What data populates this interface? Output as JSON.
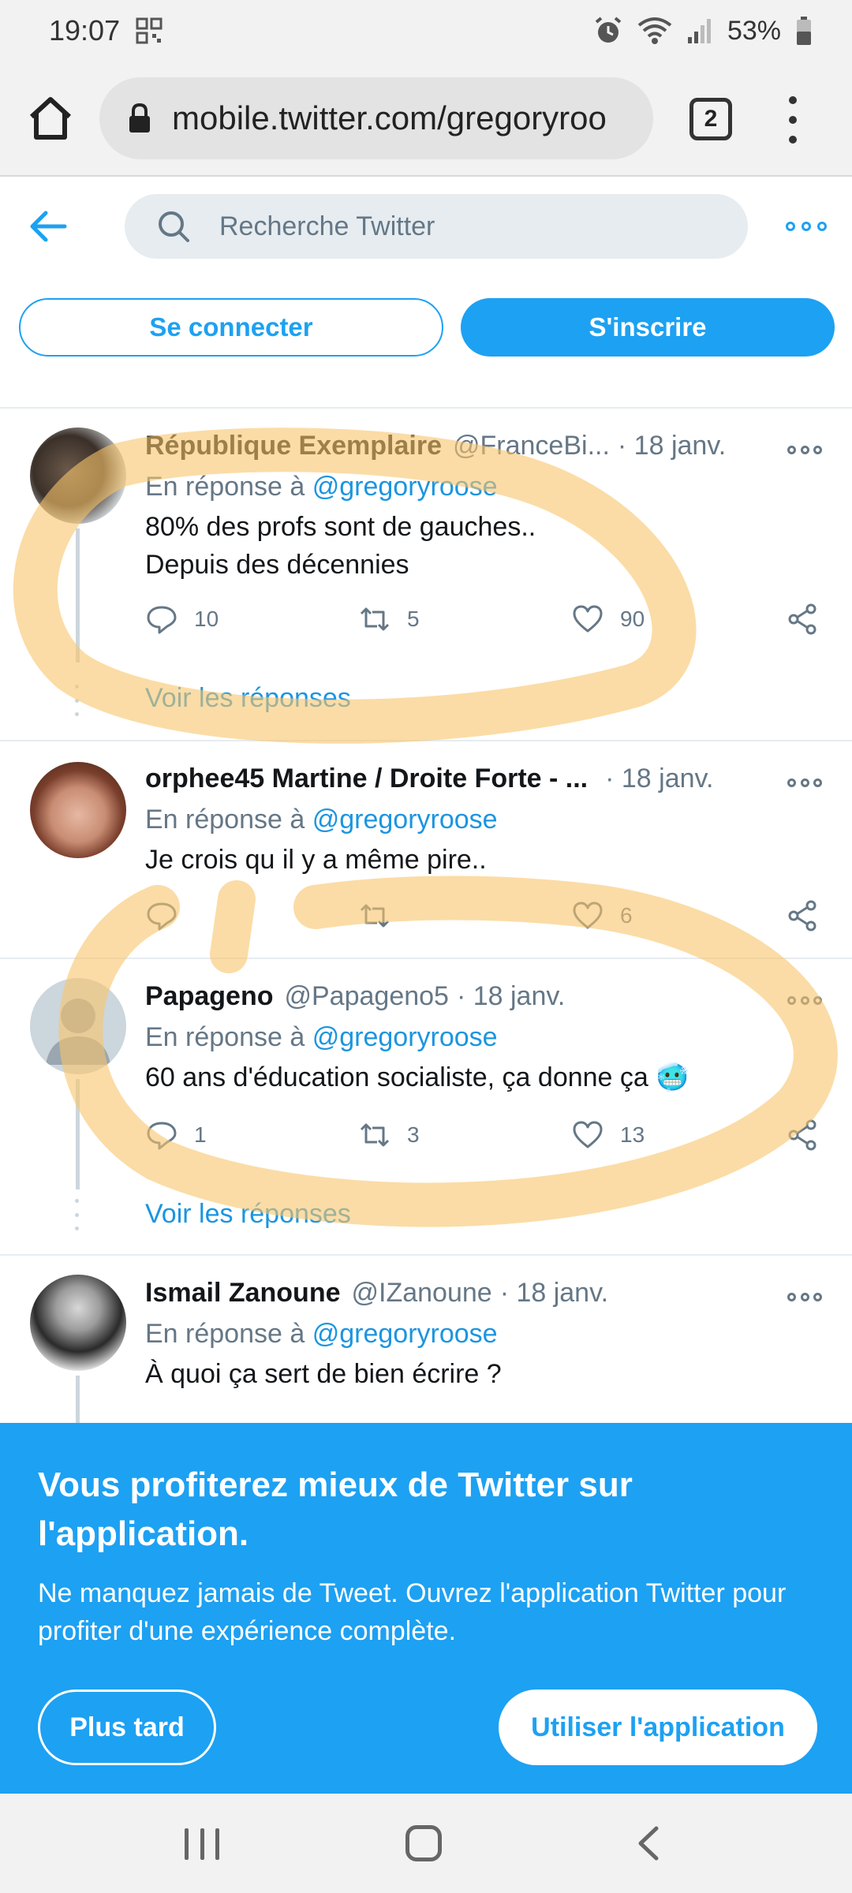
{
  "status_bar": {
    "time": "19:07",
    "battery": "53%",
    "icons": [
      "qr-code-icon",
      "alarm-icon",
      "wifi-icon",
      "signal-icon",
      "battery-icon"
    ]
  },
  "browser": {
    "url": "mobile.twitter.com/gregoryroo",
    "tab_count": "2",
    "icons": [
      "home-icon",
      "lock-icon",
      "tabs-icon",
      "kebab-menu-icon"
    ]
  },
  "header": {
    "search_placeholder": "Recherche Twitter",
    "login_label": "Se connecter",
    "signup_label": "S'inscrire",
    "accent_color": "#1da1f2"
  },
  "tweets": [
    {
      "name": "République Exemplaire",
      "handle": "@FranceBi...",
      "date": "· 18 janv.",
      "reply_prefix": "En réponse à",
      "reply_mention": "@gregoryroose",
      "text_lines": [
        "80% des profs sont de gauches..",
        "Depuis des décennies"
      ],
      "replies": "10",
      "retweets": "5",
      "likes": "90",
      "see_replies": "Voir les réponses"
    },
    {
      "name": "orphee45 Martine / Droite Forte - ...",
      "handle": "",
      "date": "· 18 janv.",
      "reply_prefix": "En réponse à",
      "reply_mention": "@gregoryroose",
      "text_lines": [
        "Je crois qu il y a même pire.."
      ],
      "replies": "",
      "retweets": "",
      "likes": "6"
    },
    {
      "name": "Papageno",
      "handle": "@Papageno5",
      "date": "· 18 janv.",
      "reply_prefix": "En réponse à",
      "reply_mention": "@gregoryroose",
      "text_lines": [
        "60 ans d'éducation socialiste, ça donne ça 🥶"
      ],
      "replies": "1",
      "retweets": "3",
      "likes": "13",
      "see_replies": "Voir les réponses"
    },
    {
      "name": "Ismail Zanoune",
      "handle": "@IZanoune",
      "date": "· 18 janv.",
      "reply_prefix": "En réponse à",
      "reply_mention": "@gregoryroose",
      "text_lines": [
        "À quoi ça sert de bien écrire ?"
      ]
    }
  ],
  "promo": {
    "title": "Vous profiterez mieux de Twitter sur l'application.",
    "description": "Ne manquez jamais de Tweet. Ouvrez l'application Twitter pour profiter d'une expérience complète.",
    "later_label": "Plus tard",
    "app_label": "Utiliser l'application"
  },
  "nav": {
    "icons": [
      "recent-apps-icon",
      "home-circle-icon",
      "back-chevron-icon"
    ]
  },
  "highlight_color": "#f9c46b"
}
